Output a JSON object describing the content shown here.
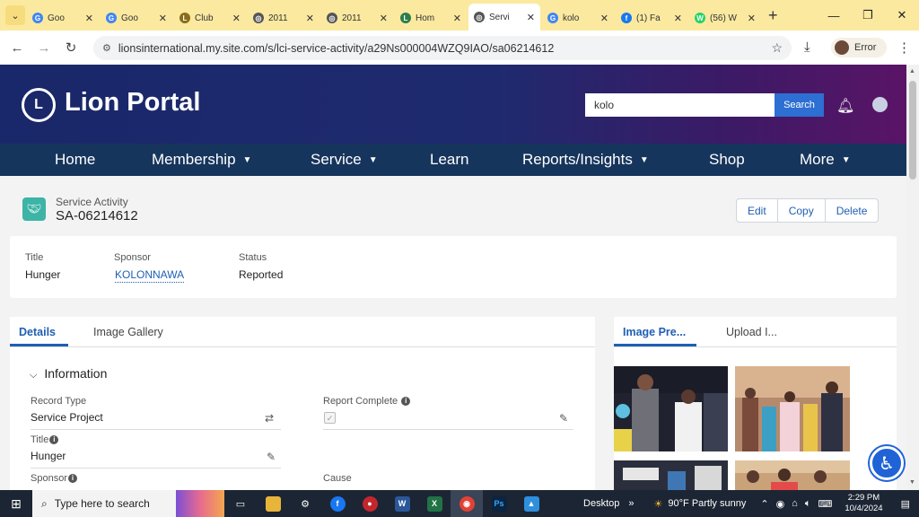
{
  "browser": {
    "tabs": [
      {
        "label": "Goo",
        "fav_color": "#4285f4",
        "fav_glyph": "G"
      },
      {
        "label": "Goo",
        "fav_color": "#4285f4",
        "fav_glyph": "G"
      },
      {
        "label": "Club",
        "fav_color": "#8a6d1b",
        "fav_glyph": "L"
      },
      {
        "label": "2011",
        "fav_color": "#555555",
        "fav_glyph": "◎"
      },
      {
        "label": "2011",
        "fav_color": "#555555",
        "fav_glyph": "◎"
      },
      {
        "label": "Hom",
        "fav_color": "#2c7d4a",
        "fav_glyph": "L"
      },
      {
        "label": "Servi",
        "fav_color": "#555555",
        "fav_glyph": "◎"
      },
      {
        "label": "kolo",
        "fav_color": "#4285f4",
        "fav_glyph": "G"
      },
      {
        "label": "(1) Fa",
        "fav_color": "#1877f2",
        "fav_glyph": "f"
      },
      {
        "label": "(56) W",
        "fav_color": "#25d366",
        "fav_glyph": "W"
      }
    ],
    "url": "lionsinternational.my.site.com/s/lci-service-activity/a29Ns000004WZQ9IAO/sa06214612",
    "profile_label": "Error"
  },
  "header": {
    "logo_text": "L",
    "brand": "Lion Portal",
    "search_value": "kolo",
    "search_button": "Search"
  },
  "nav": {
    "items": [
      {
        "label": "Home",
        "has_menu": false
      },
      {
        "label": "Membership",
        "has_menu": true
      },
      {
        "label": "Service",
        "has_menu": true
      },
      {
        "label": "Learn",
        "has_menu": false
      },
      {
        "label": "Reports/Insights",
        "has_menu": true
      },
      {
        "label": "Shop",
        "has_menu": false
      },
      {
        "label": "More",
        "has_menu": true
      }
    ]
  },
  "record": {
    "type_label": "Service Activity",
    "name": "SA-06214612",
    "actions": [
      "Edit",
      "Copy",
      "Delete"
    ]
  },
  "highlights": {
    "title_label": "Title",
    "title_value": "Hunger",
    "sponsor_label": "Sponsor",
    "sponsor_value": "KOLONNAWA",
    "status_label": "Status",
    "status_value": "Reported"
  },
  "details": {
    "tabs": [
      "Details",
      "Image Gallery"
    ],
    "section_title": "Information",
    "record_type_label": "Record Type",
    "record_type_value": "Service Project",
    "report_complete_label": "Report Complete",
    "report_complete_checked": true,
    "title_label": "Title",
    "title_value": "Hunger",
    "sponsor_label": "Sponsor",
    "cause_label": "Cause"
  },
  "image_panel": {
    "tabs": [
      "Image Pre...",
      "Upload I..."
    ]
  },
  "taskbar": {
    "search_placeholder": "Type here to search",
    "desktop_label": "Desktop",
    "weather": "90°F  Partly sunny",
    "time": "2:29 PM",
    "date": "10/4/2024"
  },
  "colors": {
    "header_start": "#19286a",
    "header_end": "#5a1466",
    "nav_bg": "#16355c",
    "accent_blue": "#1f5fb3",
    "record_icon": "#3cb4a6"
  }
}
